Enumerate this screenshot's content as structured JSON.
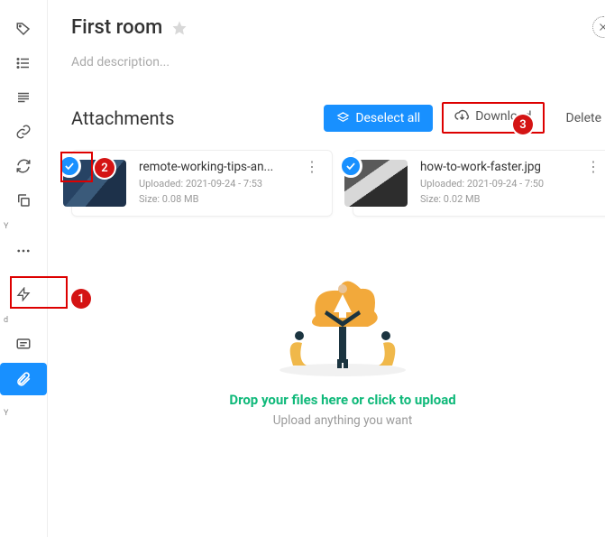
{
  "header": {
    "title": "First room",
    "description_placeholder": "Add description..."
  },
  "section": {
    "title": "Attachments"
  },
  "actions": {
    "deselect": "Deselect all",
    "download": "Download",
    "delete": "Delete"
  },
  "attachments": [
    {
      "filename": "remote-working-tips-an...",
      "uploaded": "Uploaded: 2021-09-24 - 7:53",
      "size": "Size: 0.08 MB"
    },
    {
      "filename": "how-to-work-faster.jpg",
      "uploaded": "Uploaded: 2021-09-24 - 7:50",
      "size": "Size: 0.02 MB"
    }
  ],
  "dropzone": {
    "title": "Drop your files here or click to upload",
    "subtitle": "Upload anything you want"
  },
  "sidebar": {
    "groups": [
      "Y",
      "d",
      "Y"
    ]
  },
  "callouts": {
    "one": "1",
    "two": "2",
    "three": "3"
  }
}
